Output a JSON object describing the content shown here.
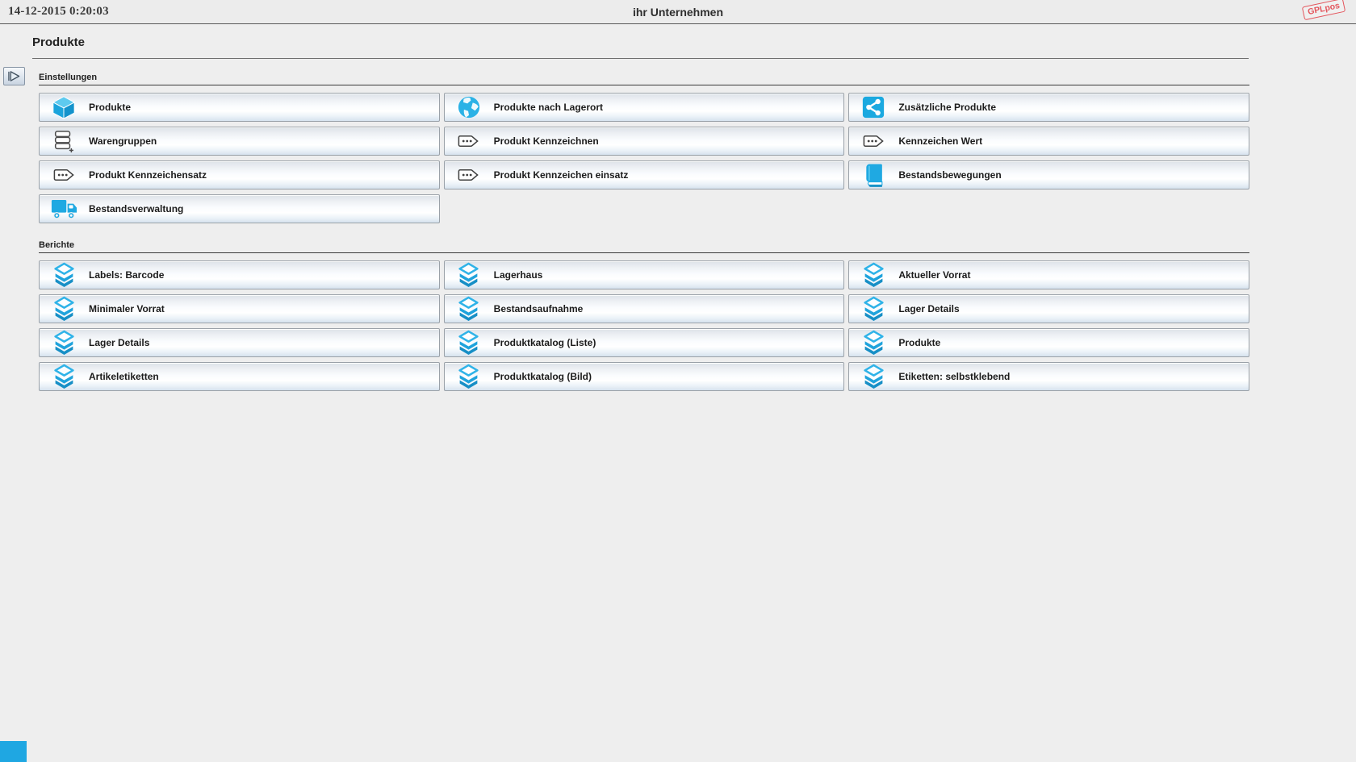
{
  "topbar": {
    "datetime": "14-12-2015 0:20:03",
    "company": "ihr Unternehmen",
    "logo": "GPLpos"
  },
  "page": {
    "title": "Produkte"
  },
  "sections": [
    {
      "label": "Einstellungen",
      "buttons": [
        {
          "label": "Produkte",
          "icon": "cube-icon"
        },
        {
          "label": "Produkte nach Lagerort",
          "icon": "globe-icon"
        },
        {
          "label": "Zusätzliche Produkte",
          "icon": "share-icon"
        },
        {
          "label": "Warengruppen",
          "icon": "stack-add-icon"
        },
        {
          "label": "Produkt Kennzeichnen",
          "icon": "tag-dots-icon"
        },
        {
          "label": "Kennzeichen Wert",
          "icon": "tag-dots-icon"
        },
        {
          "label": "Produkt Kennzeichensatz",
          "icon": "tag-dots-icon"
        },
        {
          "label": "Produkt Kennzeichen einsatz",
          "icon": "tag-dots-icon"
        },
        {
          "label": "Bestandsbewegungen",
          "icon": "book-icon"
        },
        {
          "label": "Bestandsverwaltung",
          "icon": "truck-icon"
        }
      ]
    },
    {
      "label": "Berichte",
      "buttons": [
        {
          "label": "Labels: Barcode",
          "icon": "layers-icon"
        },
        {
          "label": "Lagerhaus",
          "icon": "layers-icon"
        },
        {
          "label": "Aktueller Vorrat",
          "icon": "layers-icon"
        },
        {
          "label": "Minimaler Vorrat",
          "icon": "layers-icon"
        },
        {
          "label": "Bestandsaufnahme",
          "icon": "layers-icon"
        },
        {
          "label": "Lager Details",
          "icon": "layers-icon"
        },
        {
          "label": "Lager Details",
          "icon": "layers-icon"
        },
        {
          "label": "Produktkatalog (Liste)",
          "icon": "layers-icon"
        },
        {
          "label": "Produkte",
          "icon": "layers-icon"
        },
        {
          "label": "Artikeletiketten",
          "icon": "layers-icon"
        },
        {
          "label": "Produktkatalog (Bild)",
          "icon": "layers-icon"
        },
        {
          "label": "Etiketten: selbstklebend",
          "icon": "layers-icon"
        }
      ]
    }
  ],
  "colors": {
    "accent_cyan": "#1fa9e2",
    "stamp_red": "#e23b44",
    "background": "#eeeeee"
  }
}
